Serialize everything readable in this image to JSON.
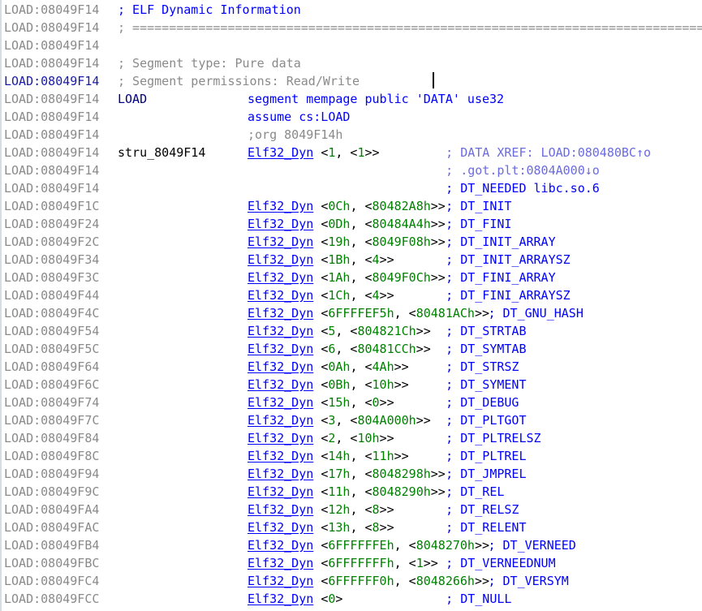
{
  "header": {
    "addr": "LOAD:08049F14",
    "title": "; ELF Dynamic Information",
    "separator": "; ==================================================================================================================",
    "segment_type": "; Segment type: Pure data",
    "segment_perms": "; Segment permissions: Read/Write",
    "segment_name": "LOAD",
    "segment_directive": "segment mempage public 'DATA' use32",
    "assume": "assume cs:LOAD",
    "org": ";org 8049F14h"
  },
  "first_struct": {
    "label": "stru_8049F14",
    "xref1": "; DATA XREF: LOAD:080480BC↑o",
    "xref2": "; .got.plt:0804A000↓o",
    "needed": "; DT_NEEDED libc.so.6"
  },
  "dyn_entries": [
    {
      "addr": "LOAD:08049F14",
      "args": "<1, <1>>",
      "comment": ""
    },
    {
      "addr": "LOAD:08049F1C",
      "args": "<0Ch, <80482A8h>>",
      "comment": "; DT_INIT"
    },
    {
      "addr": "LOAD:08049F24",
      "args": "<0Dh, <80484A4h>>",
      "comment": "; DT_FINI"
    },
    {
      "addr": "LOAD:08049F2C",
      "args": "<19h, <8049F08h>>",
      "comment": "; DT_INIT_ARRAY"
    },
    {
      "addr": "LOAD:08049F34",
      "args": "<1Bh, <4>>",
      "comment": "; DT_INIT_ARRAYSZ"
    },
    {
      "addr": "LOAD:08049F3C",
      "args": "<1Ah, <8049F0Ch>>",
      "comment": "; DT_FINI_ARRAY"
    },
    {
      "addr": "LOAD:08049F44",
      "args": "<1Ch, <4>>",
      "comment": "; DT_FINI_ARRAYSZ"
    },
    {
      "addr": "LOAD:08049F4C",
      "args": "<6FFFFEF5h, <80481ACh>>",
      "comment": "; DT_GNU_HASH"
    },
    {
      "addr": "LOAD:08049F54",
      "args": "<5, <804821Ch>>",
      "comment": "; DT_STRTAB"
    },
    {
      "addr": "LOAD:08049F5C",
      "args": "<6, <80481CCh>>",
      "comment": "; DT_SYMTAB"
    },
    {
      "addr": "LOAD:08049F64",
      "args": "<0Ah, <4Ah>>",
      "comment": "; DT_STRSZ"
    },
    {
      "addr": "LOAD:08049F6C",
      "args": "<0Bh, <10h>>",
      "comment": "; DT_SYMENT"
    },
    {
      "addr": "LOAD:08049F74",
      "args": "<15h, <0>>",
      "comment": "; DT_DEBUG"
    },
    {
      "addr": "LOAD:08049F7C",
      "args": "<3, <804A000h>>",
      "comment": "; DT_PLTGOT"
    },
    {
      "addr": "LOAD:08049F84",
      "args": "<2, <10h>>",
      "comment": "; DT_PLTRELSZ"
    },
    {
      "addr": "LOAD:08049F8C",
      "args": "<14h, <11h>>",
      "comment": "; DT_PLTREL"
    },
    {
      "addr": "LOAD:08049F94",
      "args": "<17h, <8048298h>>",
      "comment": "; DT_JMPREL"
    },
    {
      "addr": "LOAD:08049F9C",
      "args": "<11h, <8048290h>>",
      "comment": "; DT_REL"
    },
    {
      "addr": "LOAD:08049FA4",
      "args": "<12h, <8>>",
      "comment": "; DT_RELSZ"
    },
    {
      "addr": "LOAD:08049FAC",
      "args": "<13h, <8>>",
      "comment": "; DT_RELENT"
    },
    {
      "addr": "LOAD:08049FB4",
      "args": "<6FFFFFFEh, <8048270h>>",
      "comment": "; DT_VERNEED"
    },
    {
      "addr": "LOAD:08049FBC",
      "args": "<6FFFFFFFh, <1>>",
      "comment": "; DT_VERNEEDNUM"
    },
    {
      "addr": "LOAD:08049FC4",
      "args": "<6FFFFFF0h, <8048266h>>",
      "comment": "; DT_VERSYM"
    },
    {
      "addr": "LOAD:08049FCC",
      "args": "<0>",
      "comment": "; DT_NULL"
    }
  ],
  "mnemonic": "Elf32_Dyn",
  "colors": {
    "address": "#8a8a8a",
    "mnemonic": "#0000ff",
    "number": "#008000",
    "comment": "#0000ff",
    "xref": "#6b6be0"
  }
}
